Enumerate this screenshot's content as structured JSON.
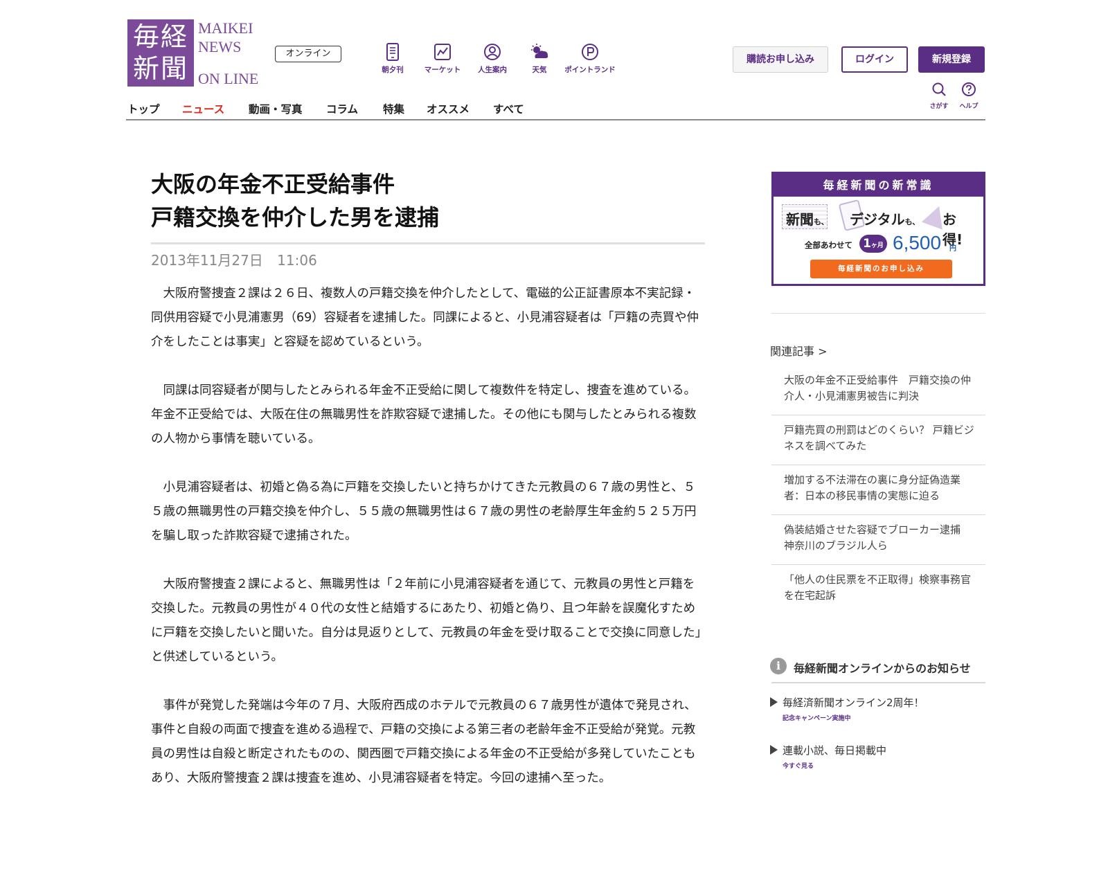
{
  "header": {
    "logo_kanji_line1": "毎経",
    "logo_kanji_line2": "新聞",
    "logo_en_line1": "MAIKEI",
    "logo_en_line2": "NEWS",
    "logo_en_line3": "ON LINE",
    "online_badge": "オンライン",
    "services": [
      {
        "label": "朝夕刊",
        "icon": "newspaper-phone-icon"
      },
      {
        "label": "マーケット",
        "icon": "chart-icon"
      },
      {
        "label": "人生案内",
        "icon": "person-icon"
      },
      {
        "label": "天気",
        "icon": "weather-icon"
      },
      {
        "label": "ポイントランド",
        "icon": "points-icon"
      }
    ],
    "subscribe_label": "購読お申し込み",
    "login_label": "ログイン",
    "register_label": "新規登録",
    "search_label": "さがす",
    "help_label": "ヘルプ"
  },
  "nav": {
    "items": [
      "トップ",
      "ニュース",
      "動画・写真",
      "コラム",
      "特集",
      "オススメ",
      "すべて"
    ],
    "active": "ニュース"
  },
  "article": {
    "headline_line1": "大阪の年金不正受給事件",
    "headline_line2": "戸籍交換を仲介した男を逮捕",
    "date": "2013年11月27日",
    "time": "11:06",
    "paragraphs": [
      "大阪府警捜査２課は２６日、複数人の戸籍交換を仲介したとして、電磁的公正証書原本不実記録・同供用容疑で小見浦憲男（69）容疑者を逮捕した。同課によると、小見浦容疑者は「戸籍の売買や仲介をしたことは事実」と容疑を認めているという。",
      "同課は同容疑者が関与したとみられる年金不正受給に関して複数件を特定し、捜査を進めている。年金不正受給では、大阪在住の無職男性を詐欺容疑で逮捕した。その他にも関与したとみられる複数の人物から事情を聴いている。",
      "小見浦容疑者は、初婚と偽る為に戸籍を交換したいと持ちかけてきた元教員の６７歳の男性と、５５歳の無職男性の戸籍交換を仲介し、５５歳の無職男性は６７歳の男性の老齢厚生年金約５２５万円を騙し取った詐欺容疑で逮捕された。",
      "大阪府警捜査２課によると、無職男性は「２年前に小見浦容疑者を通じて、元教員の男性と戸籍を交換した。元教員の男性が４０代の女性と結婚するにあたり、初婚と偽り、且つ年齢を誤魔化すために戸籍を交換したいと聞いた。自分は見返りとして、元教員の年金を受け取ることで交換に同意した」と供述しているという。",
      "事件が発覚した発端は今年の７月、大阪府西成のホテルで元教員の６７歳男性が遺体で発見され、事件と自殺の両面で捜査を進める過程で、戸籍の交換による第三者の老齢年金不正受給が発覚。元教員の男性は自殺と断定されたものの、関西圏で戸籍交換による年金の不正受給が多発していたこともあり、大阪府警捜査２課は捜査を進め、小見浦容疑者を特定。今回の逮捕へ至った。"
    ]
  },
  "promo": {
    "header": "毎経新聞の新常識",
    "word_newspaper": "新聞",
    "word_digital": "デジタル",
    "mo": "も、",
    "word_deal": "お得!",
    "total_prefix": "全部あわせて",
    "months": "1",
    "month_unit": "ヶ月",
    "price": "6,500",
    "yen": "円",
    "cta": "毎経新聞のお申し込み"
  },
  "related": {
    "title": "関連記事",
    "chevron": ">",
    "items": [
      "大阪の年金不正受給事件　戸籍交換の仲介人・小見浦憲男被告に判決",
      "戸籍売買の刑罰はどのくらい？ 戸籍ビジネスを調べてみた",
      "増加する不法滞在の裏に身分証偽造業者：日本の移民事情の実態に迫る",
      "偽装結婚させた容疑でブローカー逮捕　神奈川のブラジル人ら",
      "「他人の住民票を不正取得」検察事務官を在宅起訴"
    ]
  },
  "notices": {
    "title": "毎経新聞オンラインからのお知らせ",
    "icon_glyph": "i",
    "items": [
      {
        "main": "毎経済新聞オンライン2周年！",
        "sub": "記念キャンペーン実施中"
      },
      {
        "main": "連載小説、毎日掲載中",
        "sub": "今すぐ見る"
      }
    ]
  },
  "colors": {
    "brand_purple": "#5b2e86",
    "logo_purple": "#7b4a98",
    "nav_active_red": "#e0261a",
    "cta_orange": "#f26a1e",
    "price_blue": "#1f5fb5"
  }
}
